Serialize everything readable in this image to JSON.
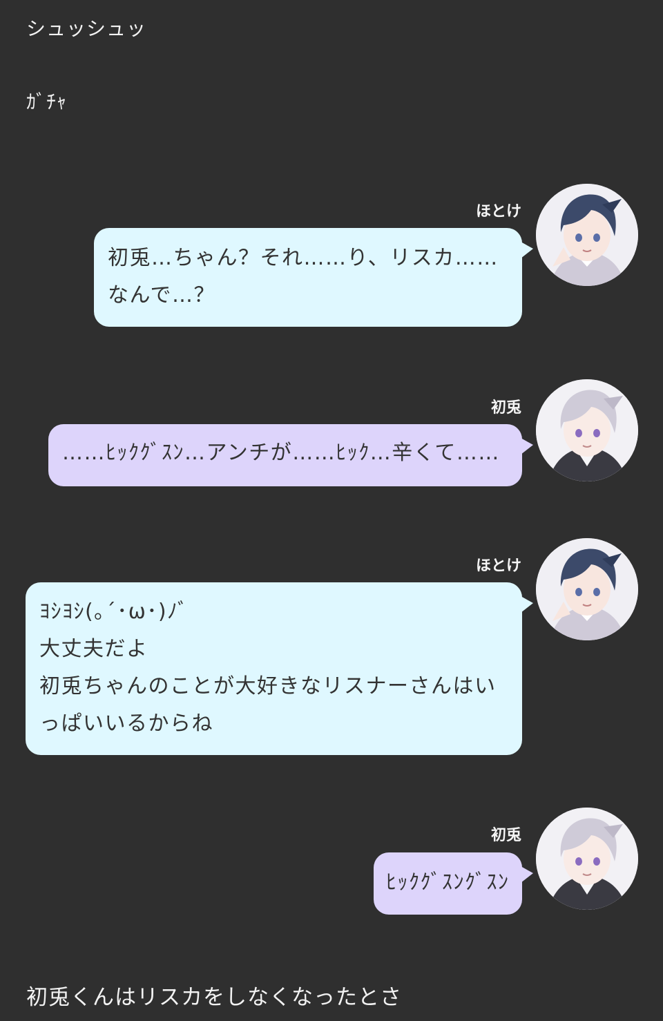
{
  "colors": {
    "background": "#2f2f2f",
    "bubble_hotoke": "#dff8ff",
    "bubble_shoto": "#ddd4fb"
  },
  "narration": {
    "sfx_1": "シュッシュッ",
    "sfx_2": "ｶﾞﾁｬ",
    "ending": "初兎くんはリスカをしなくなったとさ"
  },
  "messages": [
    {
      "speaker": "ほとけ",
      "avatar_icon": "hotoke-avatar-icon",
      "lines": [
        "初兎…ちゃん？それ……り、リスカ……",
        "なんで…？"
      ]
    },
    {
      "speaker": "初兎",
      "avatar_icon": "shoto-avatar-icon",
      "lines": [
        "……ﾋｯｸｸﾞｽﾝ…アンチが……ﾋｯｸ…辛くて……"
      ]
    },
    {
      "speaker": "ほとけ",
      "avatar_icon": "hotoke-avatar-icon",
      "lines": [
        "ﾖｼﾖｼ(｡´･ω･)ﾉﾞ",
        "大丈夫だよ",
        "初兎ちゃんのことが大好きなリスナーさんはい",
        "っぱいいるからね"
      ]
    },
    {
      "speaker": "初兎",
      "avatar_icon": "shoto-avatar-icon",
      "lines": [
        "ﾋｯｸｸﾞｽﾝｸﾞｽﾝ"
      ]
    }
  ]
}
